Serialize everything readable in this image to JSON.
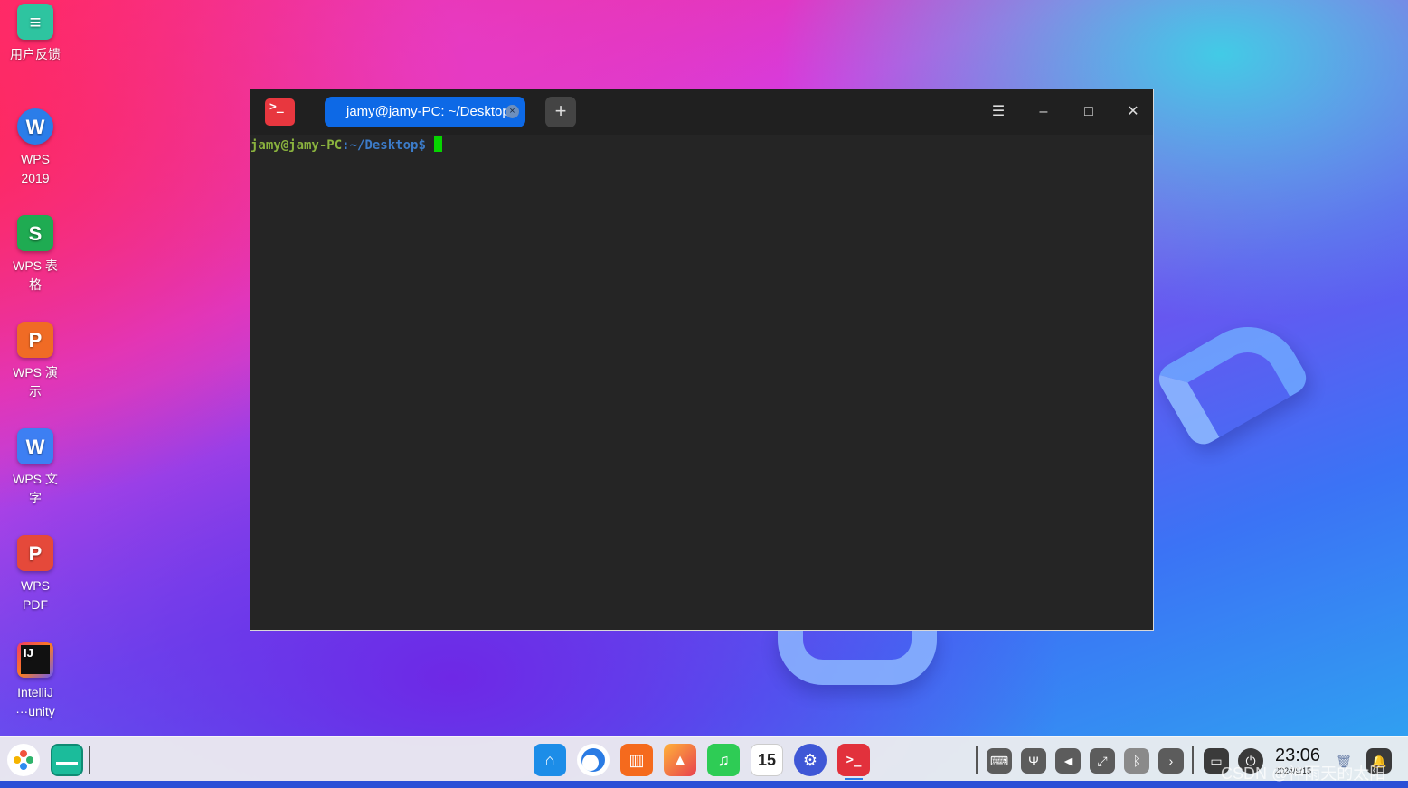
{
  "desktop": {
    "icons": [
      {
        "name": "user-feedback",
        "label": "用户反馈",
        "icon": "chat-feedback-icon",
        "color": "#2ec4a0"
      },
      {
        "name": "wps-2019",
        "label": "WPS 2019",
        "icon": "wps-icon",
        "glyph": "W",
        "color": "#2b7de9"
      },
      {
        "name": "wps-spreadsheet",
        "label": "WPS 表格",
        "icon": "wps-spreadsheet-icon",
        "glyph": "S",
        "color": "#1fab52"
      },
      {
        "name": "wps-presentation",
        "label": "WPS 演示",
        "icon": "wps-presentation-icon",
        "glyph": "P",
        "color": "#f06b25"
      },
      {
        "name": "wps-writer",
        "label": "WPS 文字",
        "icon": "wps-writer-icon",
        "glyph": "W",
        "color": "#3d7ff3"
      },
      {
        "name": "wps-pdf",
        "label": "WPS PDF",
        "icon": "wps-pdf-icon",
        "glyph": "P",
        "color": "#e5493a"
      },
      {
        "name": "intellij",
        "label": "IntelliJ ···unity",
        "icon": "intellij-icon",
        "glyph": "IJ",
        "color": "#1e1e1e"
      }
    ]
  },
  "terminal": {
    "tab_title": "jamy@jamy-PC: ~/Desktop",
    "tab_close": "×",
    "new_tab": "+",
    "menu_icon": "☰",
    "minimize": "–",
    "maximize": "□",
    "close": "✕",
    "prompt_user": "jamy@jamy-PC",
    "prompt_sep": ":",
    "prompt_path": "~/Desktop$",
    "logo_glyph": ">_"
  },
  "taskbar": {
    "clock_time": "23:06",
    "clock_date": "2024/9/15",
    "watermark": "CSDN @神雨天的太阳",
    "calendar_day": "15",
    "apps": [
      "launcher-icon",
      "multitask-view-icon",
      "app-store-icon",
      "browser-icon",
      "music-store-icon",
      "image-viewer-icon",
      "music-icon",
      "calendar-icon",
      "settings-icon",
      "terminal-icon"
    ],
    "tray": [
      "keyboard-icon",
      "usb-icon",
      "volume-mute-icon",
      "network-icon",
      "bluetooth-icon",
      "expand-arrow-icon",
      "keyboard-layout-icon",
      "power-icon",
      "trash-icon",
      "notification-icon"
    ]
  }
}
